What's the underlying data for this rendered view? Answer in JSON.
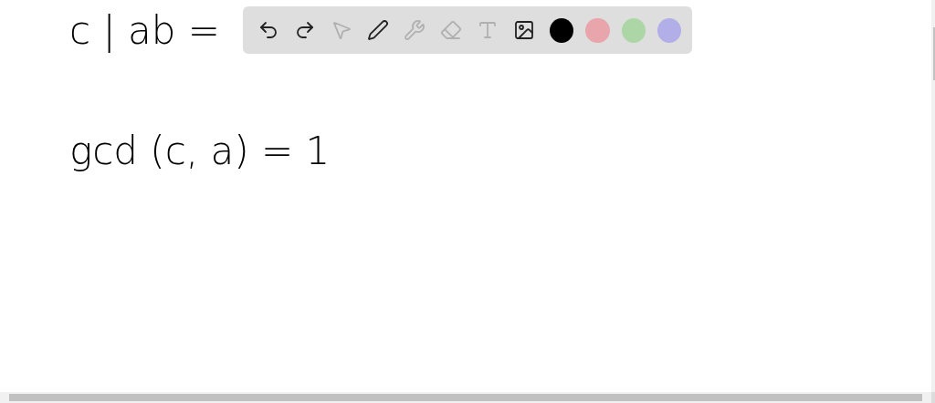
{
  "canvas": {
    "lines": [
      "c | ab =",
      "gcd (c, a) = 1"
    ]
  },
  "toolbar": {
    "tools": [
      {
        "kind": "undo",
        "disabled": false
      },
      {
        "kind": "redo",
        "disabled": false
      },
      {
        "kind": "select",
        "disabled": true
      },
      {
        "kind": "pen",
        "disabled": false
      },
      {
        "kind": "tools",
        "disabled": true
      },
      {
        "kind": "eraser",
        "disabled": true
      },
      {
        "kind": "text",
        "disabled": true
      },
      {
        "kind": "image",
        "disabled": false
      }
    ],
    "colors": [
      {
        "color": "#000000"
      },
      {
        "color": "#e8a5ab"
      },
      {
        "color": "#acd6a6"
      },
      {
        "color": "#b1aee8"
      }
    ]
  }
}
